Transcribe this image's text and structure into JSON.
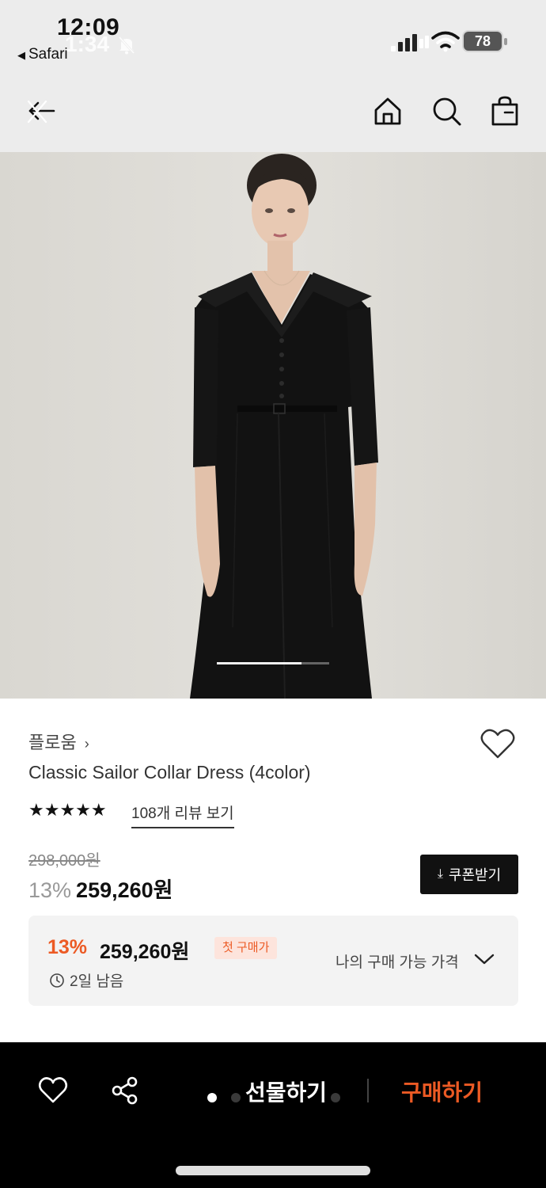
{
  "status_bar": {
    "time": "12:09",
    "ghost_time": "1:34",
    "back_app": "Safari",
    "battery": "78"
  },
  "nav": {
    "icons": [
      "back-icon",
      "home-icon",
      "search-icon",
      "shopping-bag-icon"
    ]
  },
  "hero": {
    "image": "model-in-black-sailor-collar-dress",
    "pager_progress": 0.75
  },
  "product": {
    "brand": "플로움",
    "brand_chevron": "›",
    "title": "Classic Sailor Collar Dress (4color)",
    "stars": "★★★★★",
    "rating": 5,
    "reviews_link": "108개 리뷰 보기",
    "original_price": "298,000원",
    "discount_pct": "13%",
    "price": "259,260원",
    "coupon_button": "쿠폰받기"
  },
  "deal": {
    "discount_pct": "13%",
    "price": "259,260원",
    "badge": "첫 구매가",
    "time_left": "2일 남음",
    "my_price_label": "나의 구매 가능 가격"
  },
  "bottom_bar": {
    "gift_label": "선물하기",
    "buy_label": "구매하기"
  },
  "colors": {
    "accent": "#ec5a24",
    "dark": "#111111",
    "panel_bg": "#f3f3f3"
  }
}
